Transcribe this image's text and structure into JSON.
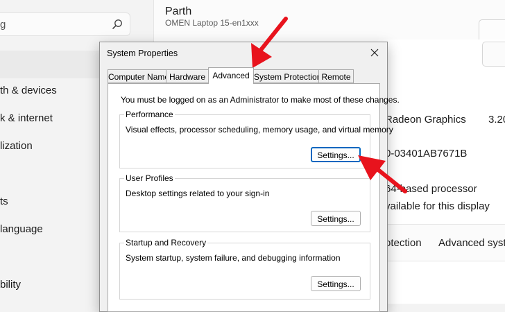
{
  "background": {
    "search": {
      "value": "g"
    },
    "sidebar": {
      "items": [
        {
          "label": "th & devices"
        },
        {
          "label": "k & internet"
        },
        {
          "label": "lization"
        },
        {
          "label": "ts"
        },
        {
          "label": "language"
        },
        {
          "label": "bility"
        }
      ]
    },
    "profile": {
      "name": "Parth",
      "model": "OMEN Laptop 15-en1xxx"
    },
    "specs": {
      "graphics": "Radeon Graphics",
      "ram_partial": "3.20",
      "device_id_partial": "0-03401AB7671B",
      "system_type_partial": "64-based processor",
      "pen_touch_partial": "vailable for this display"
    },
    "related_links": {
      "link1": "otection",
      "link2": "Advanced syste"
    }
  },
  "dialog": {
    "title": "System Properties",
    "tabs": [
      {
        "label": "Computer Name"
      },
      {
        "label": "Hardware"
      },
      {
        "label": "Advanced"
      },
      {
        "label": "System Protection"
      },
      {
        "label": "Remote"
      }
    ],
    "admin_note": "You must be logged on as an Administrator to make most of these changes.",
    "groups": {
      "performance": {
        "title": "Performance",
        "desc": "Visual effects, processor scheduling, memory usage, and virtual memory",
        "button": "Settings..."
      },
      "user_profiles": {
        "title": "User Profiles",
        "desc": "Desktop settings related to your sign-in",
        "button": "Settings..."
      },
      "startup_recovery": {
        "title": "Startup and Recovery",
        "desc": "System startup, system failure, and debugging information",
        "button": "Settings..."
      }
    }
  },
  "colors": {
    "annotation_arrow": "#e8131d",
    "focus_border": "#0067c0"
  }
}
